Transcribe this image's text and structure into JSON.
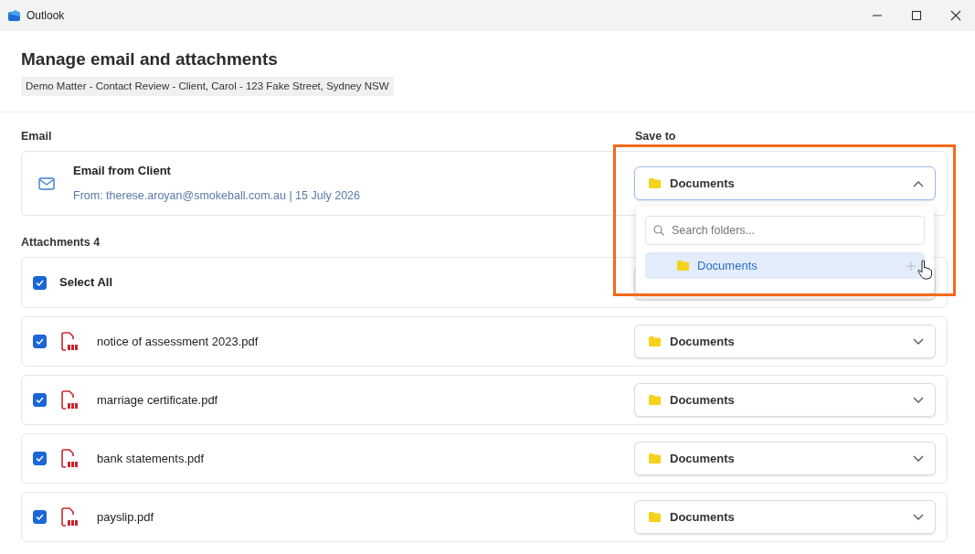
{
  "window": {
    "title": "Outlook"
  },
  "heading": "Manage email and attachments",
  "matter": "Demo Matter - Contact Review - Client, Carol - 123 Fake Street, Sydney NSW",
  "email_section": {
    "label": "Email",
    "save_to_label": "Save to",
    "email": {
      "subject": "Email from Client",
      "from": "From: therese.aroyan@smokeball.com.au | 15 July 2026",
      "folder": "Documents",
      "expanded": true
    }
  },
  "folder_menu": {
    "search_placeholder": "Search folders...",
    "items": [
      {
        "label": "Documents",
        "selected": true
      }
    ]
  },
  "attachments": {
    "label": "Attachments 4",
    "select_all": {
      "label": "Select All",
      "checked": true
    },
    "items": [
      {
        "name": "notice of assessment 2023.pdf",
        "checked": true,
        "folder": "Documents",
        "expanded": false
      },
      {
        "name": "marriage certificate.pdf",
        "checked": true,
        "folder": "Documents",
        "expanded": false
      },
      {
        "name": "bank statements.pdf",
        "checked": true,
        "folder": "Documents",
        "expanded": false
      },
      {
        "name": "payslip.pdf",
        "checked": true,
        "folder": "Documents",
        "expanded": false
      }
    ]
  }
}
